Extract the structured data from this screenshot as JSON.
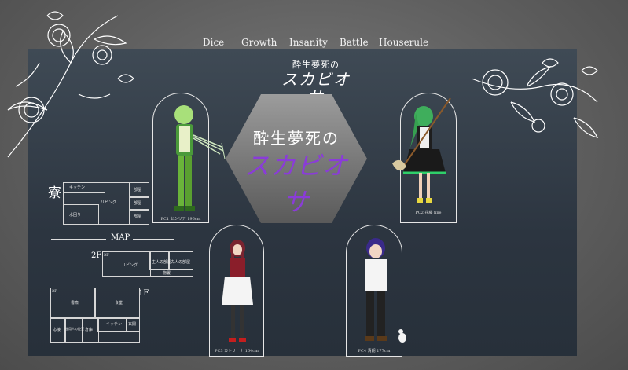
{
  "nav": [
    "Dice",
    "Growth",
    "Insanity",
    "Battle",
    "Houserule"
  ],
  "logo": {
    "line1": "酔生夢死の",
    "line2": "スカビオサ"
  },
  "center": {
    "line1": "酔生夢死の",
    "line2": "スカビオサ",
    "accent": "#8a3cd8"
  },
  "characters": [
    {
      "label": "PC1  セシリア  196cm"
    },
    {
      "label": "PC2  花藤  fine"
    },
    {
      "label": "PC3  カトリーナ  164cm"
    },
    {
      "label": "PC4  清朗  177cm"
    }
  ],
  "dorm": {
    "title": "寮",
    "rooms": [
      "キッチン",
      "リビング",
      "水回り",
      "部屋",
      "部屋",
      "部屋"
    ]
  },
  "map": {
    "title": "MAP",
    "floor2": "2F",
    "floor1": "1F",
    "rooms2f": [
      "リビング",
      "2F",
      "主人の部屋",
      "夫人の部屋",
      "物置"
    ],
    "rooms1f": [
      "2F",
      "書斎",
      "食堂",
      "応接",
      "使用人の控室",
      "倉庫",
      "キッチン",
      "玄関"
    ]
  }
}
